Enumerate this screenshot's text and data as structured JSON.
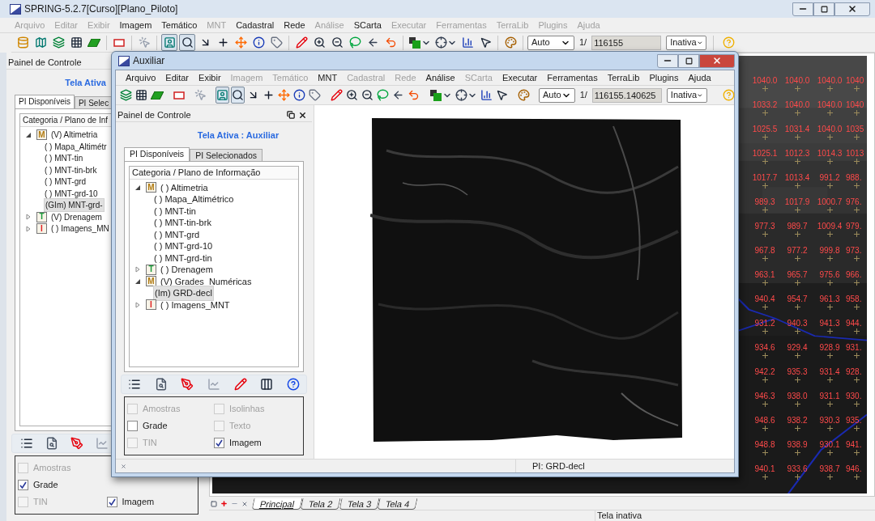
{
  "main_window": {
    "title": "SPRING-5.2.7[Curso][Plano_Piloto]",
    "menu": [
      {
        "label": "Arquivo",
        "disabled": true
      },
      {
        "label": "Editar",
        "disabled": true
      },
      {
        "label": "Exibir",
        "disabled": true
      },
      {
        "label": "Imagem",
        "disabled": false
      },
      {
        "label": "Temático",
        "disabled": false
      },
      {
        "label": "MNT",
        "disabled": true
      },
      {
        "label": "Cadastral",
        "disabled": false
      },
      {
        "label": "Rede",
        "disabled": false
      },
      {
        "label": "Análise",
        "disabled": true
      },
      {
        "label": "SCarta",
        "disabled": false
      },
      {
        "label": "Executar",
        "disabled": true
      },
      {
        "label": "Ferramentas",
        "disabled": true
      },
      {
        "label": "TerraLib",
        "disabled": true
      },
      {
        "label": "Plugins",
        "disabled": true
      },
      {
        "label": "Ajuda",
        "disabled": true
      }
    ],
    "toolbar": {
      "pressed": [
        false,
        false,
        false,
        false,
        false,
        false,
        false,
        true,
        true,
        false,
        false,
        false,
        false,
        false,
        false,
        false,
        false,
        false,
        false,
        false,
        false,
        false,
        false,
        false,
        false,
        false
      ],
      "scale_mode": "Auto",
      "scale_prefix": "1/",
      "scale": "116155",
      "state": "Inativa"
    },
    "control_panel": {
      "title": "Painel de Controle",
      "active_screen": "Tela Ativa",
      "tabs": [
        {
          "label": "PI Disponíveis",
          "selected": true
        },
        {
          "label": "PI Selec",
          "selected": false
        }
      ],
      "tree_header": "Categoria / Plano de Inf",
      "tree": [
        {
          "label": "(V) Altimetria",
          "badge": "M",
          "color": "#b07a10",
          "expanded": true,
          "selected": false,
          "children": [
            {
              "label": "( ) Mapa_Altimétr",
              "selected": false
            },
            {
              "label": "( ) MNT-tin",
              "selected": false
            },
            {
              "label": "( ) MNT-tin-brk",
              "selected": false
            },
            {
              "label": "( ) MNT-grd",
              "selected": false
            },
            {
              "label": "( ) MNT-grd-10",
              "selected": false
            },
            {
              "label": "(GIm) MNT-grd-",
              "selected": true
            }
          ]
        },
        {
          "label": "(V) Drenagem",
          "badge": "T",
          "color": "#1a9a3a",
          "expanded": false,
          "selected": false
        },
        {
          "label": "( ) Imagens_MN",
          "badge": "I",
          "color": "#e02020",
          "expanded": false,
          "selected": false
        }
      ],
      "options": [
        [
          {
            "label": "Amostras",
            "checked": false,
            "disabled": true
          },
          {
            "label": "Grade",
            "checked": true,
            "disabled": false
          },
          {
            "label": "TIN",
            "checked": false,
            "disabled": true
          }
        ],
        [
          {
            "label": "Imagem",
            "checked": true,
            "disabled": false
          }
        ]
      ]
    },
    "raster": {
      "rows": [
        [
          "1040.0",
          "1040.0",
          "1040.0",
          "1040"
        ],
        [
          "1033.2",
          "1040.0",
          "1040.0",
          "1040"
        ],
        [
          "1025.5",
          "1031.4",
          "1040.0",
          "1035"
        ],
        [
          "1025.1",
          "1012.3",
          "1014.3",
          "1013"
        ],
        [
          "1017.7",
          "1013.4",
          "991.2",
          "988."
        ],
        [
          "989.3",
          "1017.9",
          "1000.7",
          "976."
        ],
        [
          "977.3",
          "989.7",
          "1009.4",
          "979."
        ],
        [
          "967.8",
          "977.2",
          "999.8",
          "973."
        ],
        [
          "963.1",
          "965.7",
          "975.6",
          "966."
        ],
        [
          "940.4",
          "954.7",
          "961.3",
          "958."
        ],
        [
          "931.2",
          "940.3",
          "941.3",
          "944."
        ],
        [
          "934.6",
          "929.4",
          "928.9",
          "931."
        ],
        [
          "942.2",
          "935.3",
          "931.4",
          "928."
        ],
        [
          "946.3",
          "938.0",
          "931.1",
          "930."
        ],
        [
          "948.6",
          "938.2",
          "930.3",
          "935."
        ],
        [
          "948.8",
          "938.9",
          "930.1",
          "941."
        ],
        [
          "940.1",
          "933.6",
          "938.7",
          "946."
        ]
      ]
    },
    "screen_tabs": [
      {
        "label": "Principal",
        "selected": true
      },
      {
        "label": "Tela 2",
        "selected": false
      },
      {
        "label": "Tela 3",
        "selected": false
      },
      {
        "label": "Tela 4",
        "selected": false
      }
    ],
    "status": "Tela inativa"
  },
  "aux_window": {
    "title": "Auxiliar",
    "menu": [
      {
        "label": "Arquivo",
        "disabled": false
      },
      {
        "label": "Editar",
        "disabled": false
      },
      {
        "label": "Exibir",
        "disabled": false
      },
      {
        "label": "Imagem",
        "disabled": true
      },
      {
        "label": "Temático",
        "disabled": true
      },
      {
        "label": "MNT",
        "disabled": false
      },
      {
        "label": "Cadastral",
        "disabled": true
      },
      {
        "label": "Rede",
        "disabled": true
      },
      {
        "label": "Análise",
        "disabled": false
      },
      {
        "label": "SCarta",
        "disabled": true
      },
      {
        "label": "Executar",
        "disabled": false
      },
      {
        "label": "Ferramentas",
        "disabled": false
      },
      {
        "label": "TerraLib",
        "disabled": false
      },
      {
        "label": "Plugins",
        "disabled": false
      },
      {
        "label": "Ajuda",
        "disabled": false
      }
    ],
    "toolbar": {
      "pressed": [
        false,
        false,
        false,
        false,
        false,
        true,
        true,
        false,
        false,
        false,
        false,
        false,
        false,
        false,
        false,
        false,
        false,
        false,
        false,
        false,
        false,
        false,
        false,
        false
      ],
      "scale_mode": "Auto",
      "scale_prefix": "1/",
      "scale": "116155.140625",
      "state": "Inativa"
    },
    "control_panel": {
      "title": "Painel de Controle",
      "active_screen": "Tela Ativa : Auxiliar",
      "tabs": [
        {
          "label": "PI Disponíveis",
          "selected": true
        },
        {
          "label": "PI Selecionados",
          "selected": false
        }
      ],
      "tree_header": "Categoria / Plano de Informação",
      "tree": [
        {
          "label": "( ) Altimetria",
          "badge": "M",
          "color": "#b07a10",
          "expanded": true,
          "selected": false,
          "children": [
            {
              "label": "( ) Mapa_Altimétrico",
              "selected": false
            },
            {
              "label": "( ) MNT-tin",
              "selected": false
            },
            {
              "label": "( ) MNT-tin-brk",
              "selected": false
            },
            {
              "label": "( ) MNT-grd",
              "selected": false
            },
            {
              "label": "( ) MNT-grd-10",
              "selected": false
            },
            {
              "label": "( ) MNT-grd-tin",
              "selected": false
            }
          ]
        },
        {
          "label": "( ) Drenagem",
          "badge": "T",
          "color": "#1a9a3a",
          "expanded": false,
          "selected": false
        },
        {
          "label": "(V) Grades_Numéricas",
          "badge": "M",
          "color": "#b07a10",
          "expanded": true,
          "selected": false,
          "children": [
            {
              "label": "(Im) GRD-decl",
              "selected": true
            }
          ]
        },
        {
          "label": "( ) Imagens_MNT",
          "badge": "I",
          "color": "#e02020",
          "expanded": false,
          "selected": false
        }
      ],
      "options": [
        [
          {
            "label": "Amostras",
            "checked": false,
            "disabled": true
          },
          {
            "label": "Grade",
            "checked": false,
            "disabled": false
          },
          {
            "label": "TIN",
            "checked": false,
            "disabled": true
          }
        ],
        [
          {
            "label": "Isolinhas",
            "checked": false,
            "disabled": true
          },
          {
            "label": "Texto",
            "checked": false,
            "disabled": true
          },
          {
            "label": "Imagem",
            "checked": true,
            "disabled": false
          }
        ]
      ]
    },
    "status": "PI: GRD-decl"
  }
}
